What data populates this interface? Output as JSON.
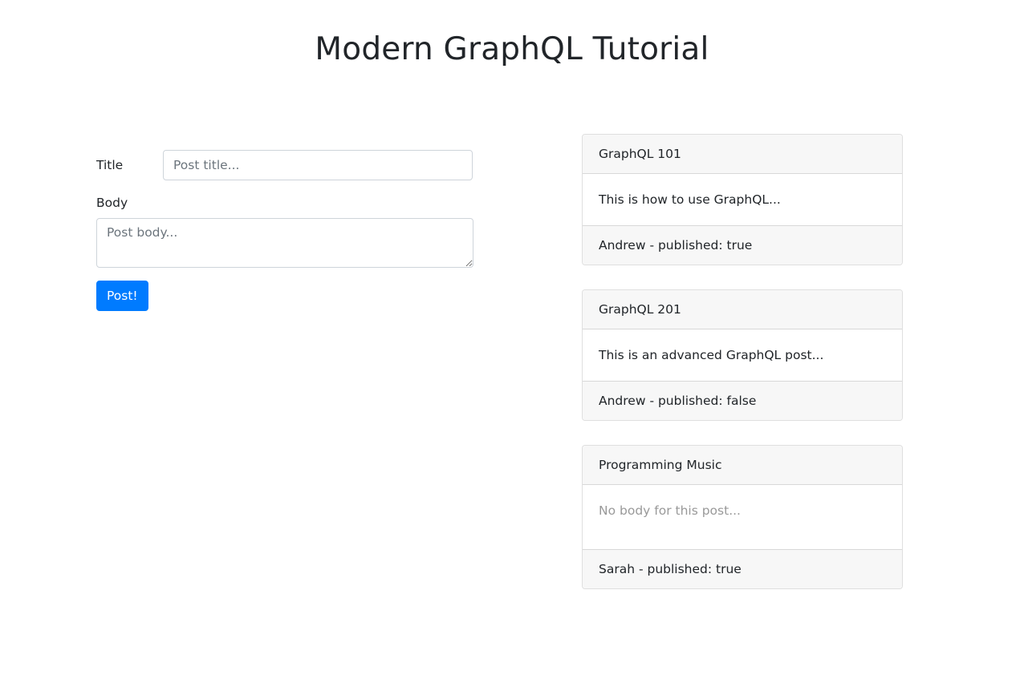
{
  "page": {
    "title": "Modern GraphQL Tutorial"
  },
  "form": {
    "title_label": "Title",
    "title_placeholder": "Post title...",
    "body_label": "Body",
    "body_placeholder": "Post body...",
    "submit_label": "Post!"
  },
  "posts": [
    {
      "title": "GraphQL 101",
      "body": "This is how to use GraphQL...",
      "footer": "Andrew - published: true"
    },
    {
      "title": "GraphQL 201",
      "body": "This is an advanced GraphQL post...",
      "footer": "Andrew - published: false"
    },
    {
      "title": "Programming Music",
      "body": "No body for this post...",
      "footer": "Sarah - published: true"
    }
  ],
  "colors": {
    "primary": "#007bff",
    "card_header_bg": "#f7f7f7",
    "muted_text": "#999999"
  }
}
